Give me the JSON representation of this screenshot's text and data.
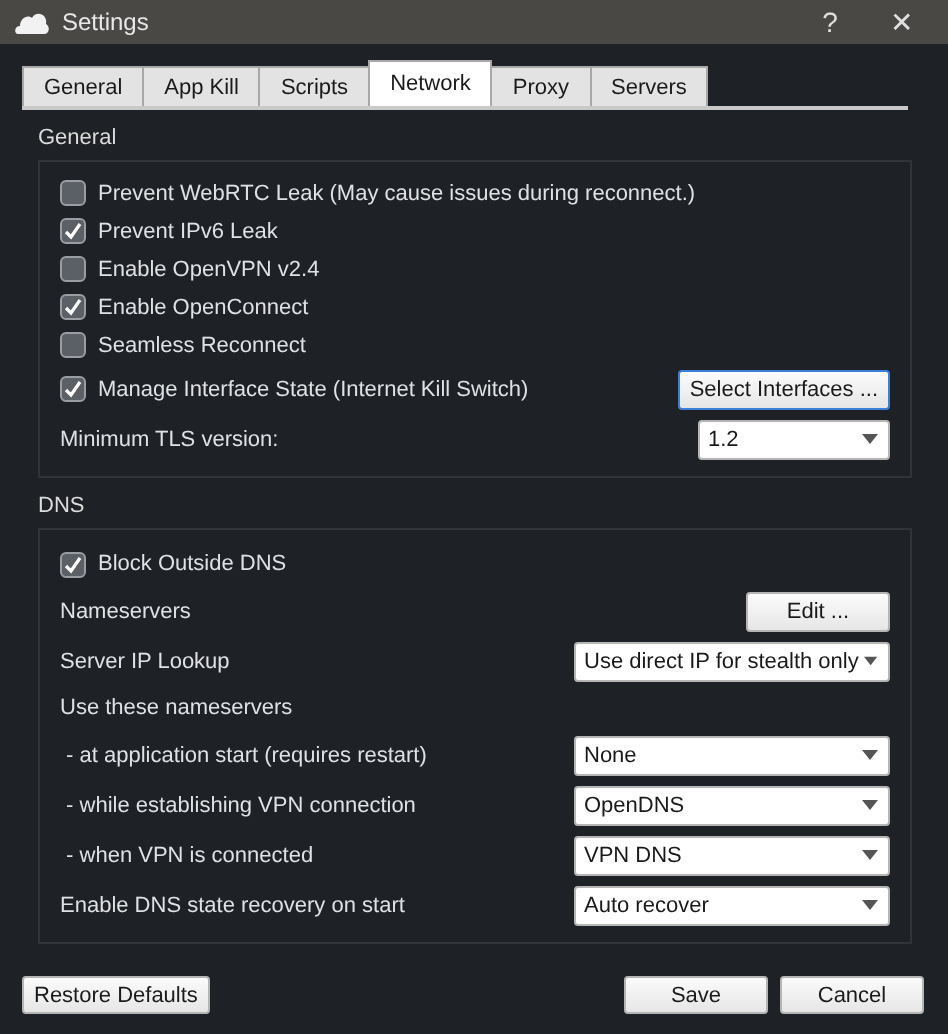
{
  "window": {
    "title": "Settings",
    "help": "?",
    "close": "✕"
  },
  "tabs": [
    {
      "label": "General",
      "selected": false
    },
    {
      "label": "App Kill",
      "selected": false
    },
    {
      "label": "Scripts",
      "selected": false
    },
    {
      "label": "Network",
      "selected": true
    },
    {
      "label": "Proxy",
      "selected": false
    },
    {
      "label": "Servers",
      "selected": false
    }
  ],
  "sections": [
    {
      "title": "General",
      "rows": [
        {
          "kind": "checkbox",
          "label": "Prevent WebRTC Leak (May cause issues during reconnect.)",
          "checked": false
        },
        {
          "kind": "checkbox",
          "label": "Prevent IPv6 Leak",
          "checked": true
        },
        {
          "kind": "checkbox",
          "label": "Enable OpenVPN v2.4",
          "checked": false
        },
        {
          "kind": "checkbox",
          "label": "Enable OpenConnect",
          "checked": true
        },
        {
          "kind": "checkbox",
          "label": "Seamless Reconnect",
          "checked": false
        },
        {
          "kind": "checkbox",
          "label": "Manage Interface State (Internet Kill Switch)",
          "checked": true,
          "control": {
            "kind": "button",
            "label": "Select Interfaces ...",
            "focused": true
          }
        },
        {
          "kind": "text",
          "label": "Minimum TLS version:",
          "control": {
            "kind": "combo",
            "value": "1.2",
            "wide": false
          }
        }
      ]
    },
    {
      "title": "DNS",
      "rows": [
        {
          "kind": "checkbox",
          "label": "Block Outside DNS",
          "checked": true
        },
        {
          "kind": "text",
          "label": "Nameservers",
          "control": {
            "kind": "button",
            "label": "Edit ...",
            "focused": false
          }
        },
        {
          "kind": "text",
          "label": "Server IP Lookup",
          "control": {
            "kind": "combo",
            "value": "Use direct IP for stealth only",
            "wide": true
          }
        },
        {
          "kind": "text",
          "label": "Use these nameservers"
        },
        {
          "kind": "text",
          "label": " - at application start (requires restart)",
          "control": {
            "kind": "combo",
            "value": "None",
            "wide": true
          }
        },
        {
          "kind": "text",
          "label": " - while establishing VPN connection",
          "control": {
            "kind": "combo",
            "value": "OpenDNS",
            "wide": true
          }
        },
        {
          "kind": "text",
          "label": " - when VPN is connected",
          "control": {
            "kind": "combo",
            "value": "VPN DNS",
            "wide": true
          }
        },
        {
          "kind": "text",
          "label": "Enable DNS state recovery on start",
          "control": {
            "kind": "combo",
            "value": "Auto recover",
            "wide": true
          }
        }
      ]
    }
  ],
  "footer": {
    "restore": "Restore Defaults",
    "save": "Save",
    "cancel": "Cancel"
  }
}
